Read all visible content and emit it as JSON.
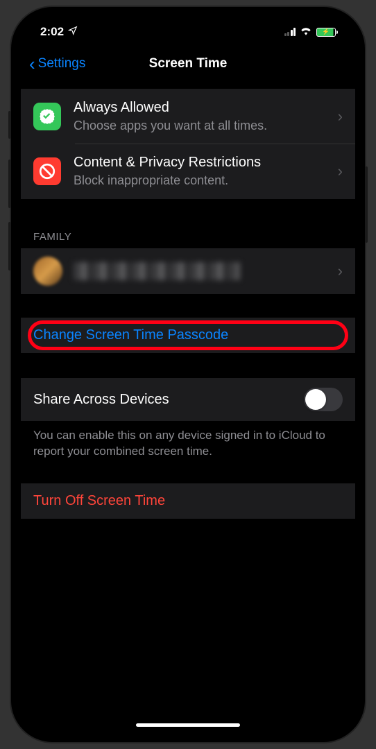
{
  "status": {
    "time": "2:02"
  },
  "nav": {
    "back_label": "Settings",
    "title": "Screen Time"
  },
  "rows": {
    "always": {
      "title": "Always Allowed",
      "sub": "Choose apps you want at all times."
    },
    "content": {
      "title": "Content & Privacy Restrictions",
      "sub": "Block inappropriate content."
    }
  },
  "family": {
    "header": "FAMILY"
  },
  "change_passcode": {
    "label": "Change Screen Time Passcode"
  },
  "share": {
    "title": "Share Across Devices",
    "footer": "You can enable this on any device signed in to iCloud to report your combined screen time."
  },
  "turnoff": {
    "label": "Turn Off Screen Time"
  }
}
